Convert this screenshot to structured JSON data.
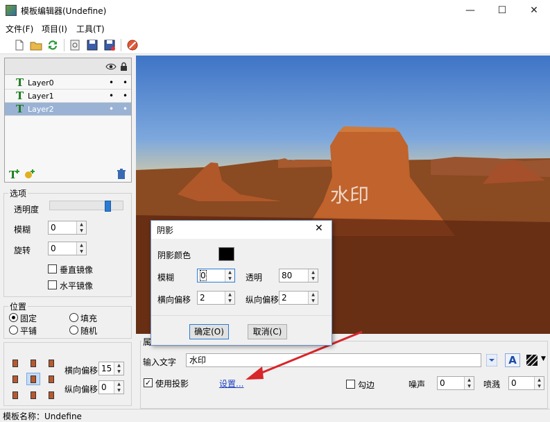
{
  "window": {
    "title": "模板编辑器(Undefine)",
    "minimize": "—",
    "maximize": "☐",
    "close": "✕"
  },
  "menu": [
    "文件(F)",
    "项目(I)",
    "工具(T)"
  ],
  "toolbar_icons": [
    "new-file-icon",
    "open-folder-icon",
    "refresh-icon",
    "preview-icon",
    "save-icon",
    "save-as-icon",
    "stop-icon"
  ],
  "layers": {
    "header_icons": [
      "eye-icon",
      "lock-icon"
    ],
    "items": [
      {
        "glyph": "T",
        "name": "Layer0",
        "selected": false,
        "d1": "•",
        "d2": "•"
      },
      {
        "glyph": "T",
        "name": "Layer1",
        "selected": false,
        "d1": "•",
        "d2": "•"
      },
      {
        "glyph": "T",
        "name": "Layer2",
        "selected": true,
        "d1": "•",
        "d2": "•"
      }
    ]
  },
  "options": {
    "title": "选项",
    "opacity_label": "透明度",
    "opacity_value": 0.82,
    "blur_label": "模糊",
    "blur_value": "0",
    "rotate_label": "旋转",
    "rotate_value": "0",
    "flip_v_label": "垂直镜像",
    "flip_h_label": "水平镜像"
  },
  "position": {
    "title": "位置",
    "fixed": "固定",
    "fill": "填充",
    "tile": "平铺",
    "random": "随机",
    "h_offset_label": "横向偏移",
    "h_offset_value": "15",
    "v_offset_label": "纵向偏移",
    "v_offset_value": "0"
  },
  "canvas": {
    "watermark": "水印"
  },
  "props": {
    "title_partial": "属",
    "input_label": "输入文字",
    "input_value": "水印",
    "shadow_label": "使用投影",
    "settings_link": "设置...",
    "outline_label": "勾边",
    "noise_label": "噪声",
    "noise_value": "0",
    "spray_label": "喷溅",
    "spray_value": "0",
    "font_button": "A"
  },
  "dialog": {
    "title": "阴影",
    "close": "✕",
    "color_label": "阴影颜色",
    "color_value": "#000000",
    "blur_label": "模糊",
    "blur_value": "0",
    "opacity_label": "透明",
    "opacity_value": "80",
    "h_offset_label": "横向偏移",
    "h_offset_value": "2",
    "v_offset_label": "纵向偏移",
    "v_offset_value": "2",
    "ok": "确定(O)",
    "cancel": "取消(C)"
  },
  "status": {
    "text": "模板名称：Undefine"
  }
}
